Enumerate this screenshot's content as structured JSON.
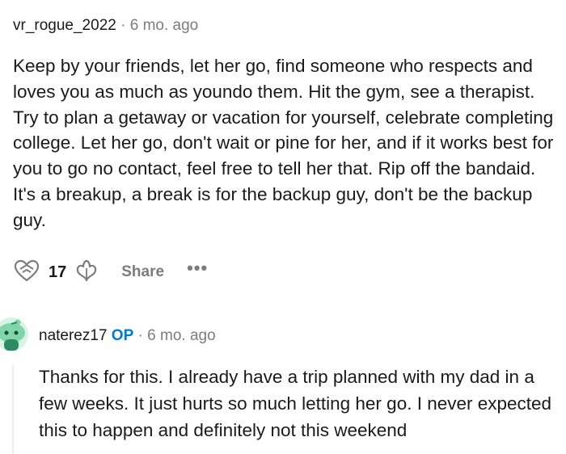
{
  "comments": [
    {
      "username": "vr_rogue_2022",
      "separator": "·",
      "time": "6 mo. ago",
      "body": "Keep by your friends, let her go, find someone who respects and loves you as much as youndo them. Hit the gym, see a therapist. Try to plan a getaway or vacation for yourself, celebrate completing college. Let her go, don't wait or pine for her, and if it works best for you to go no contact, feel free to tell her that. Rip off the bandaid. It's a breakup, a break is for the backup guy, don't be the backup guy.",
      "votes": "17",
      "share_label": "Share",
      "more_label": "•••"
    },
    {
      "username": "naterez17",
      "op_badge": "OP",
      "separator": "·",
      "time": "6 mo. ago",
      "body": "Thanks for this. I already have a trip planned with my dad in a few weeks. It just hurts so much letting her go. I never expected this to happen and definitely not this weekend"
    }
  ],
  "icons": {
    "upvote": "upvote-heart-icon",
    "downvote": "downvote-icon",
    "avatar": "snoo-avatar-icon"
  },
  "colors": {
    "text": "#1a1a1b",
    "muted": "#7c7c7c",
    "op": "#0079d3",
    "avatar": "#7fd6a8"
  }
}
